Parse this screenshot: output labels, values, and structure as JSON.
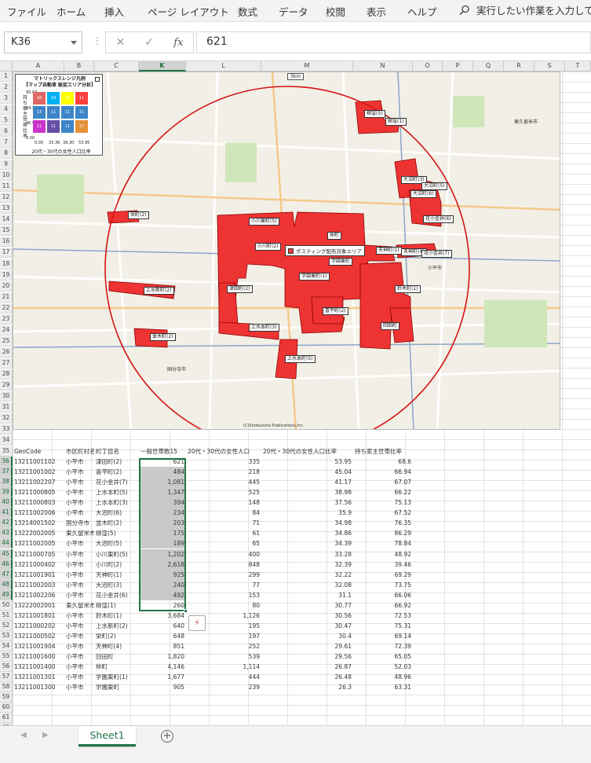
{
  "ribbon": {
    "tabs": [
      "ファイル",
      "ホーム",
      "挿入",
      "ページ レイアウト",
      "数式",
      "データ",
      "校閲",
      "表示",
      "ヘルプ"
    ],
    "search_text": "実行したい作業を入力して"
  },
  "formula_bar": {
    "name_box": "K36",
    "value": "621"
  },
  "columns": [
    "A",
    "B",
    "C",
    "K",
    "L",
    "M",
    "N",
    "O",
    "P",
    "Q",
    "R",
    "S",
    "T"
  ],
  "selected_column": "K",
  "map": {
    "scale_label": "3km",
    "copyright": "(C)Shobunsha Publications,Inc.",
    "posting_legend": "ポスティング配布対象エリア",
    "city_labels": [
      "東久留米市",
      "小平市",
      "国分寺市"
    ],
    "legend": {
      "title_line1": "マトリックスレンジ凡例",
      "title_line2": "【マップ自動車 販促エリア分析】",
      "y_axis_label": "持ち家主世帯比率",
      "y_ticks": [
        "95.07",
        "64.21",
        "46.91",
        "0.00"
      ],
      "x_ticks": [
        "0.00",
        "33.36",
        "39.30",
        "53.95"
      ],
      "x_axis_label": "20代・30代の女性人口比率",
      "cells": [
        {
          "label": "16",
          "color": "#e06666"
        },
        {
          "label": "14",
          "color": "#00b0f0"
        },
        {
          "label": "11",
          "color": "#ffff00"
        },
        {
          "label": "11",
          "color": "#ff4040"
        },
        {
          "label": "13",
          "color": "#3d85c6"
        },
        {
          "label": "11",
          "color": "#3d85c6"
        },
        {
          "label": "11",
          "color": "#3d85c6"
        },
        {
          "label": "11",
          "color": "#3d85c6"
        },
        {
          "label": "11",
          "color": "#cc33cc"
        },
        {
          "label": "11",
          "color": "#674ea7"
        },
        {
          "label": "11",
          "color": "#3d85c6"
        },
        {
          "label": "17",
          "color": "#e69138"
        }
      ]
    },
    "labels": [
      "柳窪(5)",
      "柳窪(1)",
      "大沼町(3)",
      "大沼町(5)",
      "大沼町(6)",
      "花小金井(6)",
      "栄町(2)",
      "小川東町(5)",
      "仲町",
      "小川町(2)",
      "天神町(1)",
      "天神町(4)",
      "花小金井(7)",
      "学園東町",
      "学園東町(1)",
      "津田町(2)",
      "上水新町(2)",
      "鈴木町(1)",
      "喜平町(2)",
      "回田町",
      "上水本町(3)",
      "並木町(2)",
      "上水本町(5)"
    ]
  },
  "table": {
    "headers": [
      "GeoCode",
      "市区町村名",
      "町丁目名",
      "一般世帯数15",
      "20代・30代の女性人口",
      "20代・30代の女性人口比率",
      "持ち家主世帯比率"
    ],
    "rows": [
      [
        "13211001102",
        "小平市",
        "津田町(2)",
        "621",
        "335",
        "53.95",
        "68.6"
      ],
      [
        "13211001002",
        "小平市",
        "喜平町(2)",
        "484",
        "218",
        "45.04",
        "66.94"
      ],
      [
        "13211002207",
        "小平市",
        "花小金井(7)",
        "1,081",
        "445",
        "41.17",
        "67.07"
      ],
      [
        "13211000805",
        "小平市",
        "上水本町(5)",
        "1,347",
        "525",
        "38.98",
        "66.22"
      ],
      [
        "13211000803",
        "小平市",
        "上水本町(3)",
        "394",
        "148",
        "37.56",
        "75.13"
      ],
      [
        "13211002006",
        "小平市",
        "大沼町(6)",
        "234",
        "84",
        "35.9",
        "67.52"
      ],
      [
        "13214001502",
        "国分寺市",
        "並木町(2)",
        "203",
        "71",
        "34.98",
        "76.35"
      ],
      [
        "13222002005",
        "東久留米市",
        "柳窪(5)",
        "175",
        "61",
        "34.86",
        "86.29"
      ],
      [
        "13211002005",
        "小平市",
        "大沼町(5)",
        "189",
        "65",
        "34.39",
        "78.84"
      ],
      [
        "13211000705",
        "小平市",
        "小川東町(5)",
        "1,202",
        "400",
        "33.28",
        "48.92"
      ],
      [
        "13211000402",
        "小平市",
        "小川町(2)",
        "2,618",
        "848",
        "32.39",
        "39.46"
      ],
      [
        "13211001901",
        "小平市",
        "天神町(1)",
        "925",
        "299",
        "32.22",
        "69.29"
      ],
      [
        "13211002003",
        "小平市",
        "大沼町(3)",
        "240",
        "77",
        "32.08",
        "73.75"
      ],
      [
        "13211002206",
        "小平市",
        "花小金井(6)",
        "492",
        "153",
        "31.1",
        "66.06"
      ],
      [
        "13222002001",
        "東久留米市",
        "柳窪(1)",
        "260",
        "80",
        "30.77",
        "66.92"
      ],
      [
        "13211001801",
        "小平市",
        "鈴木町(1)",
        "3,684",
        "1,126",
        "30.56",
        "72.53"
      ],
      [
        "13211000202",
        "小平市",
        "上水新町(2)",
        "640",
        "195",
        "30.47",
        "75.31"
      ],
      [
        "13211000502",
        "小平市",
        "栄町(2)",
        "648",
        "197",
        "30.4",
        "69.14"
      ],
      [
        "13211001904",
        "小平市",
        "天神町(4)",
        "851",
        "252",
        "29.61",
        "72.39"
      ],
      [
        "13211001600",
        "小平市",
        "回田町",
        "1,820",
        "539",
        "29.56",
        "65.05"
      ],
      [
        "13211001400",
        "小平市",
        "仲町",
        "4,146",
        "1,114",
        "26.87",
        "52.03"
      ],
      [
        "13211001301",
        "小平市",
        "学園東町(1)",
        "1,677",
        "444",
        "26.48",
        "48.96"
      ],
      [
        "13211001300",
        "小平市",
        "学園東町",
        "905",
        "239",
        "26.3",
        "63.31"
      ]
    ]
  },
  "sheet_tabs": {
    "active": "Sheet1",
    "add_label": "+"
  }
}
